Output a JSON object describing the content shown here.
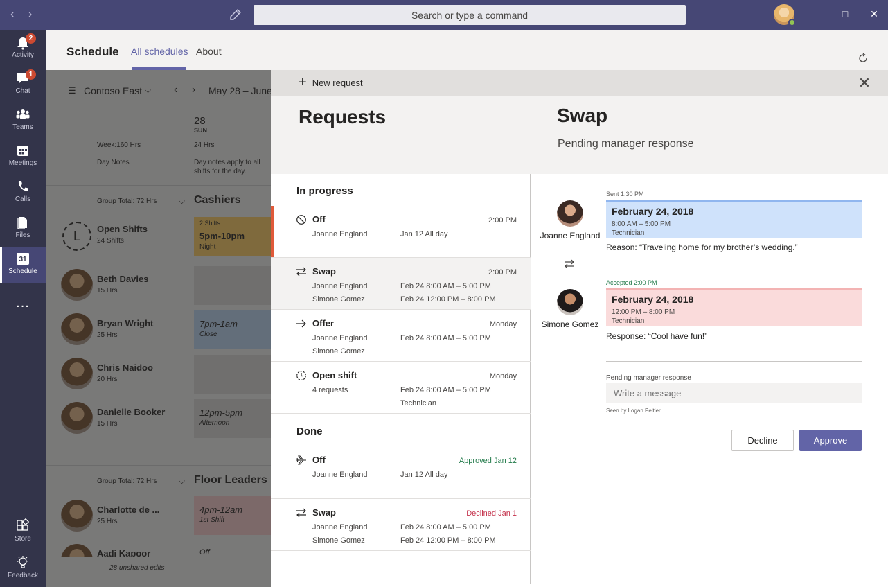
{
  "titlebar": {
    "search_placeholder": "Search or type a command"
  },
  "rail": {
    "items": [
      {
        "label": "Activity",
        "badge": "2"
      },
      {
        "label": "Chat",
        "badge": "1"
      },
      {
        "label": "Teams"
      },
      {
        "label": "Meetings"
      },
      {
        "label": "Calls"
      },
      {
        "label": "Files"
      },
      {
        "label": "Schedule",
        "day": "31"
      },
      {
        "label": "Store"
      },
      {
        "label": "Feedback"
      }
    ],
    "more": "..."
  },
  "header": {
    "title": "Schedule",
    "tabs": [
      "All schedules",
      "About"
    ]
  },
  "background": {
    "team": "Contoso East",
    "date_range": "May 28 – June",
    "day_num": "28",
    "day_name": "SUN",
    "week_hrs": "Week:160 Hrs",
    "day_hrs": "24 Hrs",
    "day_notes": "Day Notes",
    "day_notes_hint_1": "Day notes apply to all",
    "day_notes_hint_2": "shifts for the day.",
    "group1_total": "Group Total: 72 Hrs",
    "group1_name": "Cashiers",
    "open_shifts": "Open Shifts",
    "open_shifts_hrs": "24 Shifts",
    "open_shift_count": "2 Shifts",
    "open_shift_time": "5pm-10pm",
    "open_shift_label": "Night",
    "people": [
      {
        "name": "Beth Davies",
        "hrs": "15 Hrs",
        "shift": "",
        "label": ""
      },
      {
        "name": "Bryan Wright",
        "hrs": "25 Hrs",
        "shift": "7pm-1am",
        "label": "Close"
      },
      {
        "name": "Chris Naidoo",
        "hrs": "20 Hrs",
        "shift": "",
        "label": ""
      },
      {
        "name": "Danielle Booker",
        "hrs": "15 Hrs",
        "shift": "12pm-5pm",
        "label": "Afternoon"
      }
    ],
    "group2_total": "Group Total: 72 Hrs",
    "group2_name": "Floor Leaders",
    "people2": [
      {
        "name": "Charlotte de ...",
        "hrs": "25 Hrs",
        "shift": "4pm-12am",
        "label": "1st Shift"
      },
      {
        "name": "Aadi Kapoor",
        "hrs": "",
        "shift": "Off",
        "label": ""
      }
    ],
    "unshared": "28 unshared edits"
  },
  "panel": {
    "new_request": "New request",
    "requests_title": "Requests",
    "detail_title": "Swap",
    "detail_status": "Pending manager response"
  },
  "requests": {
    "in_progress_title": "In progress",
    "done_title": "Done",
    "in_progress": [
      {
        "type": "Off",
        "time": "2:00 PM",
        "lines": [
          [
            "Joanne England",
            "Jan 12 All day"
          ]
        ]
      },
      {
        "type": "Swap",
        "time": "2:00 PM",
        "lines": [
          [
            "Joanne England",
            "Feb 24 8:00 AM – 5:00 PM"
          ],
          [
            "Simone Gomez",
            "Feb 24 12:00 PM – 8:00 PM"
          ]
        ]
      },
      {
        "type": "Offer",
        "time": "Monday",
        "lines": [
          [
            "Joanne England",
            "Feb 24 8:00 AM – 5:00 PM"
          ],
          [
            "Simone Gomez",
            ""
          ]
        ]
      },
      {
        "type": "Open shift",
        "time": "Monday",
        "lines": [
          [
            "4 requests",
            "Feb 24 8:00 AM – 5:00 PM"
          ],
          [
            "",
            "Technician"
          ]
        ]
      }
    ],
    "done": [
      {
        "type": "Off",
        "time": "Approved Jan 12",
        "lines": [
          [
            "Joanne England",
            "Jan 12 All day"
          ]
        ]
      },
      {
        "type": "Swap",
        "time": "Declined Jan 1",
        "lines": [
          [
            "Joanne England",
            "Feb 24 8:00 AM – 5:00 PM"
          ],
          [
            "Simone Gomez",
            "Feb 24 12:00 PM – 8:00 PM"
          ]
        ]
      }
    ]
  },
  "detail": {
    "sender": {
      "name": "Joanne England",
      "meta": "Sent 1:30 PM",
      "date": "February 24, 2018",
      "hours": "8:00 AM – 5:00 PM",
      "role": "Technician",
      "note": "Reason: “Traveling home for my brother’s wedding.”"
    },
    "receiver": {
      "name": "Simone Gomez",
      "meta": "Accepted 2:00 PM",
      "date": "February 24, 2018",
      "hours": "12:00 PM – 8:00 PM",
      "role": "Technician",
      "note": "Response: “Cool have fun!”"
    },
    "status_label": "Pending manager response",
    "message_placeholder": "Write a message",
    "seen_by": "Seen by Logan Peltier",
    "decline": "Decline",
    "approve": "Approve"
  },
  "colors": {
    "accent": "#6264a7",
    "titlebar": "#464775",
    "rail": "#33344a",
    "approved": "#237b4b",
    "declined": "#c4314b",
    "in_progress_marker": "#e05a3a"
  }
}
